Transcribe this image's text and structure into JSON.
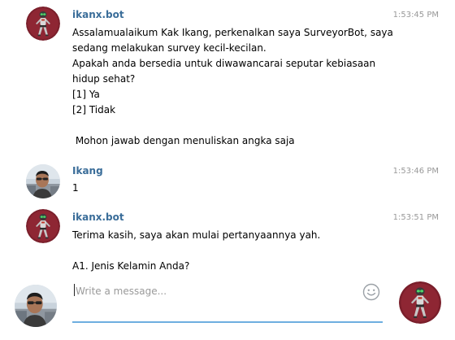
{
  "messages": [
    {
      "sender": "ikanx.bot",
      "time": "1:53:45 PM",
      "avatar": "robot-avatar-icon",
      "lines": [
        "Assalamualaikum Kak Ikang, perkenalkan saya SurveyorBot, saya",
        "sedang melakukan survey kecil-kecilan.",
        "Apakah anda bersedia untuk diwawancarai seputar kebiasaan",
        "hidup sehat?",
        "[1] Ya",
        "[2] Tidak",
        "",
        " Mohon jawab dengan menuliskan angka saja"
      ]
    },
    {
      "sender": "Ikang",
      "time": "1:53:46 PM",
      "avatar": "user-photo-avatar",
      "lines": [
        "1"
      ]
    },
    {
      "sender": "ikanx.bot",
      "time": "1:53:51 PM",
      "avatar": "robot-avatar-icon",
      "lines": [
        "Terima kasih, saya akan mulai pertanyaannya yah.",
        "",
        "A1. Jenis Kelamin Anda?"
      ]
    }
  ],
  "composer": {
    "placeholder": "Write a message...",
    "value": "",
    "emoji_icon": "smiley-icon"
  },
  "colors": {
    "sender": "#3a6d99",
    "timestamp": "#999999",
    "input_underline": "#6eaee0",
    "robot_bg": "#7a1f2b"
  }
}
